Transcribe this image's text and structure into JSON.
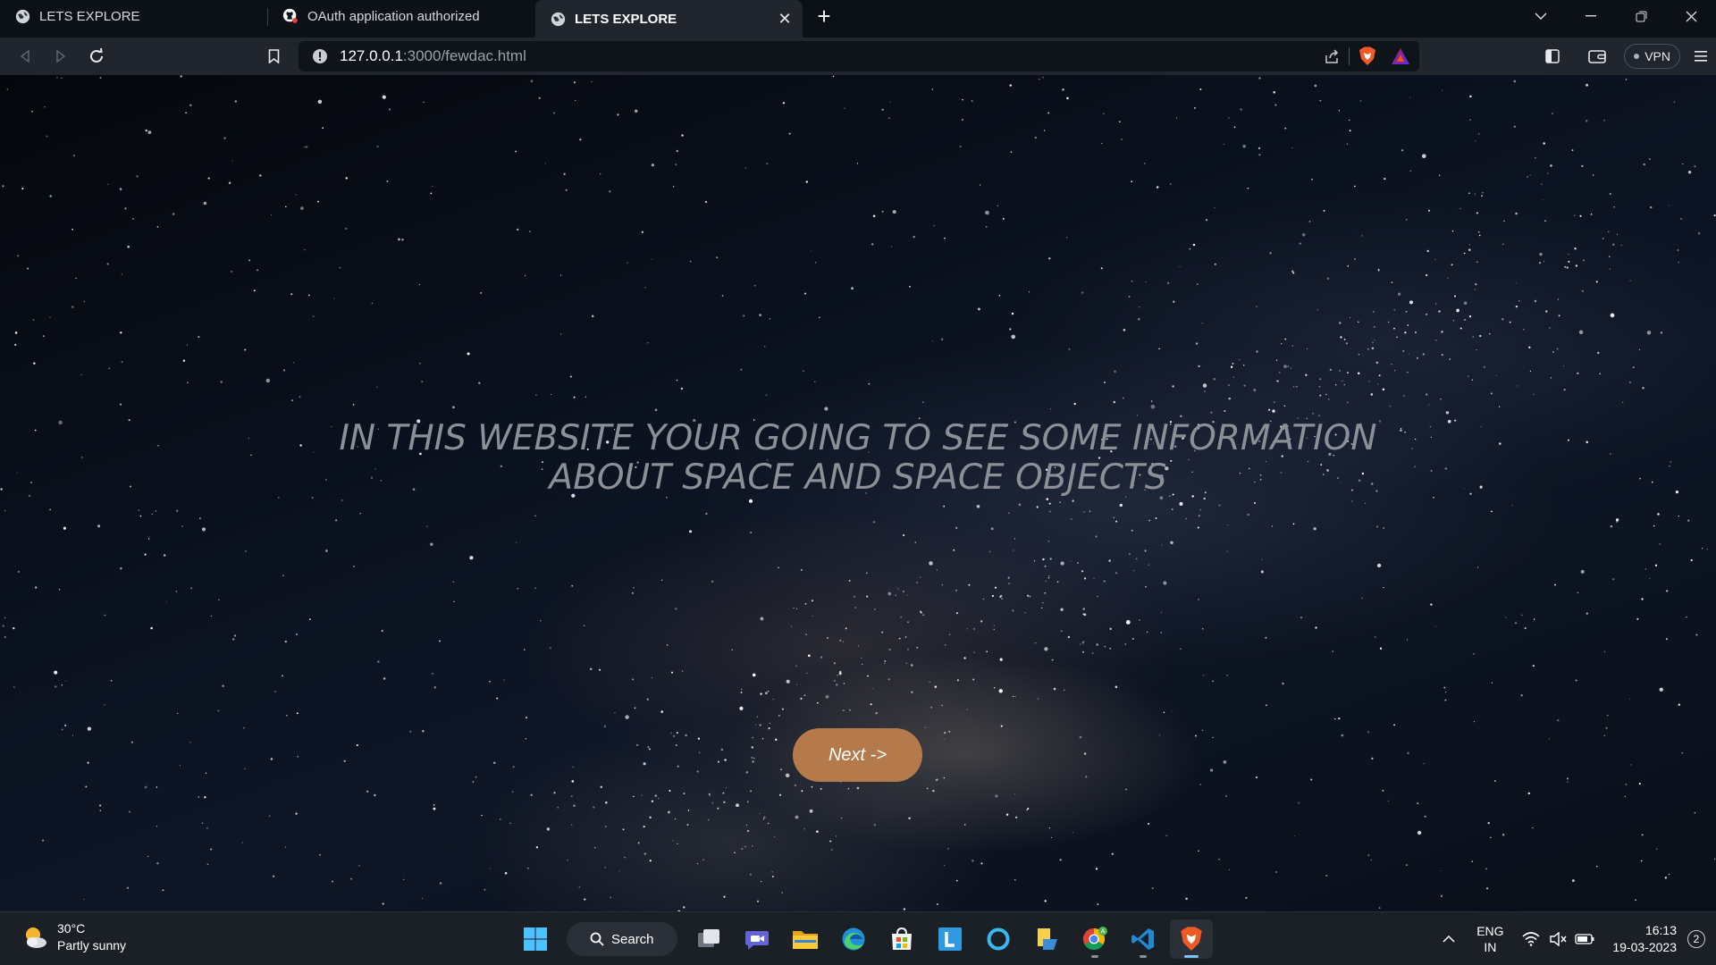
{
  "browser": {
    "tabs": [
      {
        "title": "LETS EXPLORE",
        "favicon": "globe-icon",
        "active": false
      },
      {
        "title": "OAuth application authorized",
        "favicon": "github-icon",
        "active": false
      },
      {
        "title": "LETS EXPLORE",
        "favicon": "globe-icon",
        "active": true
      }
    ],
    "address": {
      "host": "127.0.0.1",
      "rest": ":3000/fewdac.html"
    },
    "vpn_label": "VPN"
  },
  "page": {
    "heading_line1": "IN THIS WEBSITE YOUR GOING TO SEE SOME INFORMATION",
    "heading_line2": "ABOUT SPACE AND SPACE OBJECTS",
    "next_label": "Next ->",
    "colors": {
      "button": "#b47a4b",
      "heading": "#8c8f96"
    }
  },
  "taskbar": {
    "weather": {
      "temp": "30°C",
      "condition": "Partly sunny"
    },
    "search_label": "Search",
    "apps": [
      "windows-start-icon",
      "task-view-icon",
      "teams-chat-icon",
      "file-explorer-icon",
      "edge-icon",
      "store-icon",
      "l-app-icon",
      "cortana-icon",
      "sticky-notes-icon",
      "chrome-icon",
      "vscode-icon",
      "brave-icon"
    ],
    "lang_line1": "ENG",
    "lang_line2": "IN",
    "time": "16:13",
    "date": "19-03-2023",
    "notifications": "2"
  }
}
